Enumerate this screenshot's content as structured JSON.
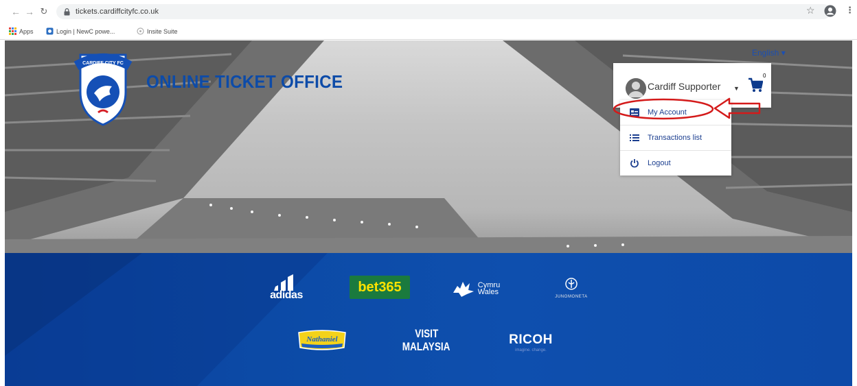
{
  "browser": {
    "url": "tickets.cardiffcityfc.co.uk",
    "bookmarks": [
      {
        "label": "Apps"
      },
      {
        "label": "Login | NewC powe..."
      },
      {
        "label": "Insite Suite"
      }
    ]
  },
  "header": {
    "crest_text": "CARDIFF CITY FC",
    "title": "ONLINE TICKET OFFICE",
    "language": "English",
    "user_name": "Cardiff Supporter",
    "cart_count": "0"
  },
  "user_menu": {
    "items": [
      {
        "label": "My Account",
        "icon": "account-card-icon"
      },
      {
        "label": "Transactions list",
        "icon": "list-icon"
      },
      {
        "label": "Logout",
        "icon": "power-icon"
      }
    ]
  },
  "sponsors": {
    "adidas": "adidas",
    "bet365": "bet365",
    "wales_line1": "Cymru",
    "wales_line2": "Wales",
    "juno": "JUNOMONETA",
    "nathaniel": "Nathaniel",
    "malaysia_line1": "VISIT",
    "malaysia_line2": "MALAYSIA",
    "ricoh": "RICOH",
    "ricoh_tag": "imagine. change."
  },
  "colors": {
    "brand_blue": "#0d4ba8",
    "annotation_red": "#d41a1a",
    "bet365_green": "#1a7a3e"
  }
}
